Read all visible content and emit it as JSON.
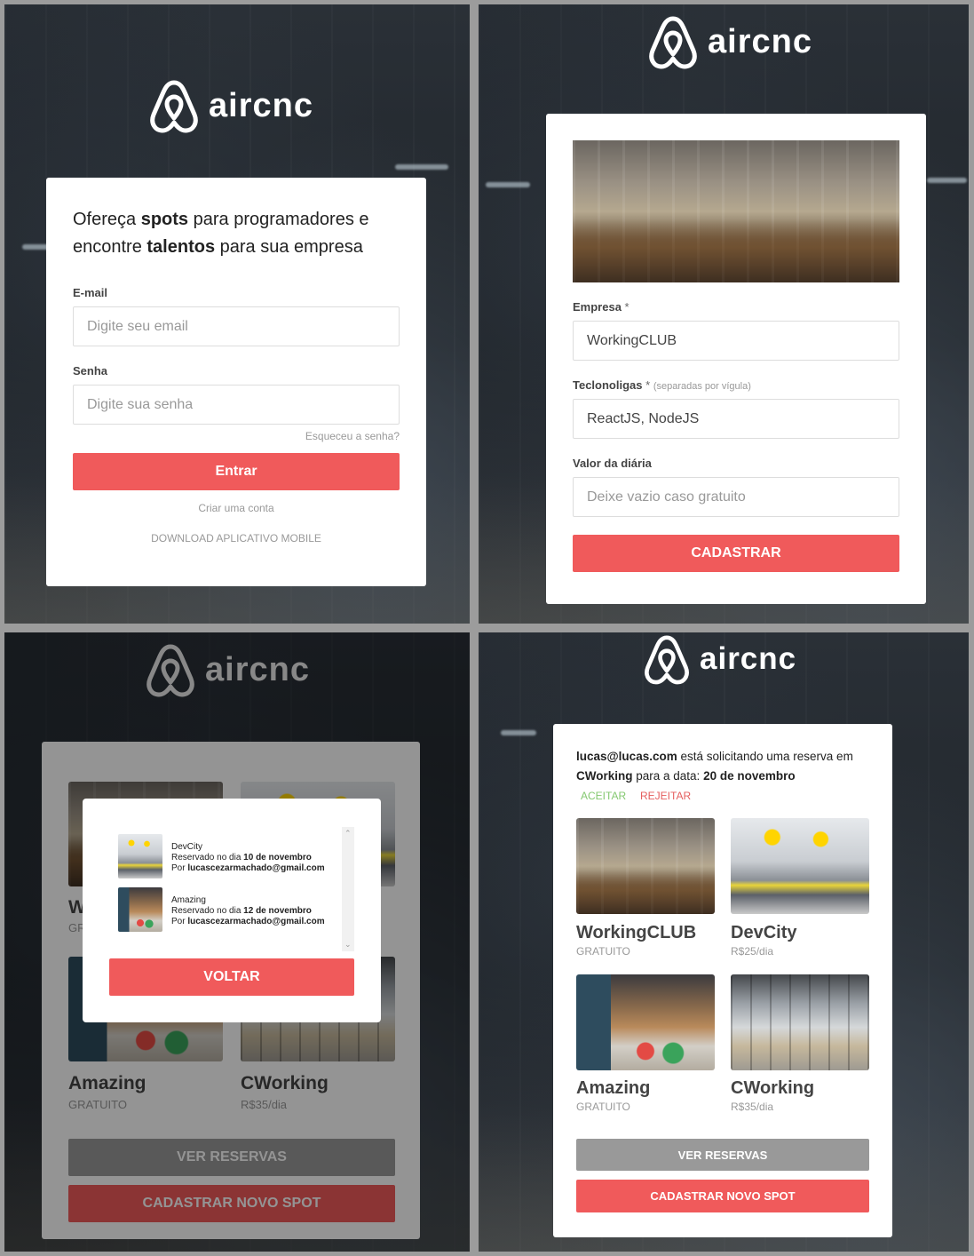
{
  "brand": {
    "name": "aircnc"
  },
  "login": {
    "headline_parts": [
      "Ofereça ",
      "spots",
      " para programadores e encontre ",
      "talentos",
      " para sua empresa"
    ],
    "email_label": "E-mail",
    "email_placeholder": "Digite seu email",
    "password_label": "Senha",
    "password_placeholder": "Digite sua senha",
    "forgot_password": "Esqueceu a senha?",
    "submit": "Entrar",
    "create_account": "Criar uma conta",
    "download_app": "DOWNLOAD APLICATIVO MOBILE"
  },
  "new_spot": {
    "company_label": "Empresa",
    "company_required": "*",
    "company_value": "WorkingCLUB",
    "techs_label": "Teclonoligas",
    "techs_required": "*",
    "techs_hint": "(separadas por vígula)",
    "techs_value": "ReactJS, NodeJS",
    "price_label": "Valor da diária",
    "price_placeholder": "Deixe vazio caso gratuito",
    "submit": "CADASTRAR"
  },
  "reservations_modal": {
    "items": [
      {
        "spot": "DevCity",
        "prefix": "Reservado no dia ",
        "date": "10 de novembro",
        "by_prefix": "Por ",
        "user": "lucascezarmachado@gmail.com"
      },
      {
        "spot": "Amazing",
        "prefix": "Reservado no dia ",
        "date": "12 de novembro",
        "by_prefix": "Por ",
        "user": "lucascezarmachado@gmail.com"
      }
    ],
    "back": "VOLTAR"
  },
  "dashboard": {
    "request": {
      "user": "lucas@lucas.com",
      "text1": " está solicitando uma reserva em ",
      "spot": "CWorking",
      "text2": " para a data: ",
      "date": "20 de novembro",
      "accept": "ACEITAR",
      "reject": "REJEITAR"
    },
    "spots": [
      {
        "name": "WorkingCLUB",
        "price": "GRATUITO"
      },
      {
        "name": "DevCity",
        "price": "R$25/dia"
      },
      {
        "name": "Amazing",
        "price": "GRATUITO"
      },
      {
        "name": "CWorking",
        "price": "R$35/dia"
      }
    ],
    "view_reservations": "VER RESERVAS",
    "new_spot": "CADASTRAR NOVO SPOT"
  },
  "colors": {
    "accent": "#f05a5b",
    "gray_button": "#999999",
    "accept": "#84c870",
    "reject": "#e55e5e"
  }
}
